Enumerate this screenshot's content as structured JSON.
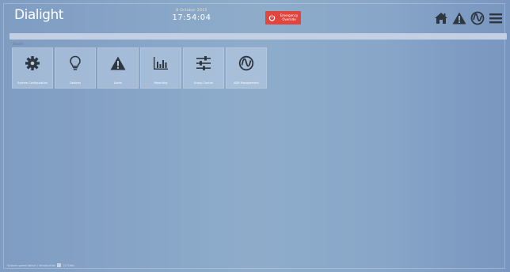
{
  "header": {
    "logo_text": "Dialight",
    "date": "8 October 2015",
    "time": "17:54:04",
    "emergency_label_line1": "Emergency",
    "emergency_label_line2": "Override"
  },
  "search": {
    "placeholder": "Search"
  },
  "tiles": [
    {
      "label": "System Configuration",
      "icon": "gear-icon"
    },
    {
      "label": "Devices",
      "icon": "lightbulb-icon"
    },
    {
      "label": "Alerts",
      "icon": "warning-icon"
    },
    {
      "label": "Reporting",
      "icon": "bar-chart-icon"
    },
    {
      "label": "Group Control",
      "icon": "sliders-icon"
    },
    {
      "label": "ADR Management",
      "icon": "adr-icon"
    }
  ],
  "footer": {
    "status_left": "System speed above / introduction",
    "status_right": "1171kbs"
  },
  "colors": {
    "emergency": "#e2453e",
    "tile_bg": "#bed0e6",
    "text": "#ffffff"
  }
}
